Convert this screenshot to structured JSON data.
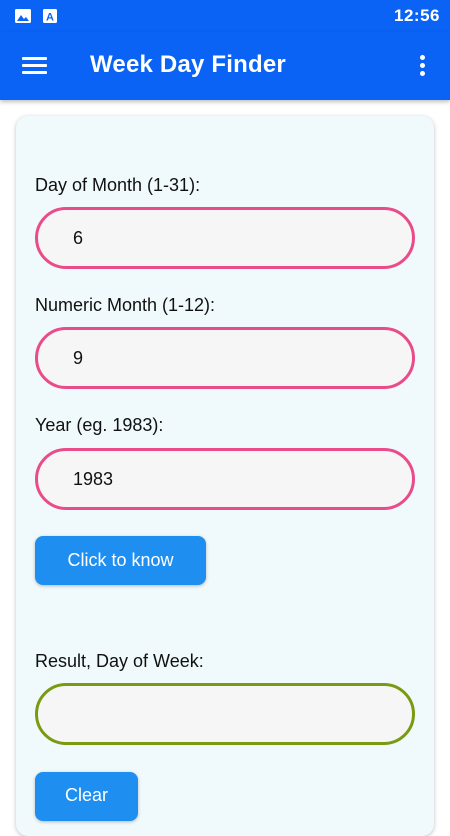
{
  "status_bar": {
    "time": "12:56",
    "icons": [
      "image-icon",
      "a-badge-icon"
    ]
  },
  "app_bar": {
    "title": "Week Day Finder",
    "color": "#0a63f5"
  },
  "form": {
    "day_label": "Day of Month (1-31):",
    "day_value": "6",
    "month_label": "Numeric Month (1-12):",
    "month_value": "9",
    "year_label": "Year (eg. 1983):",
    "year_value": "1983",
    "submit_label": "Click to know",
    "result_label": "Result, Day of Week:",
    "result_value": "",
    "clear_label": "Clear"
  },
  "colors": {
    "input_border": "#ea4c8a",
    "result_border": "#7a9a12",
    "button": "#1e8ff0",
    "card": "#f0f9fb"
  }
}
